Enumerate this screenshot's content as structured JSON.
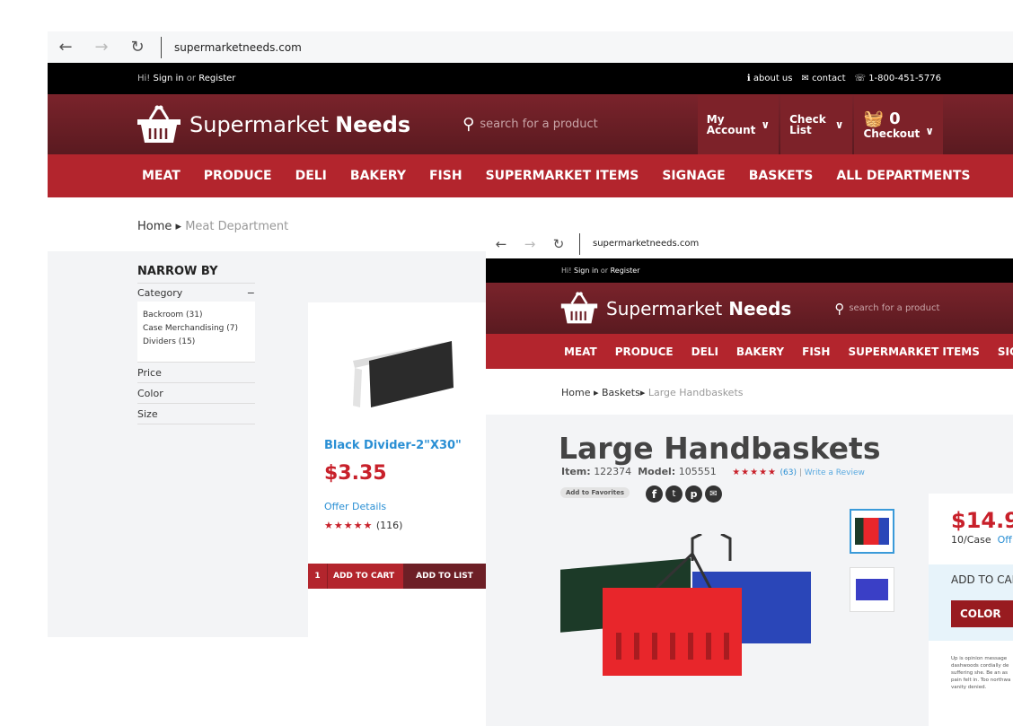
{
  "window1": {
    "url": "supermarketneeds.com",
    "topbar": {
      "greeting": "Hi!",
      "sign_in": "Sign in",
      "or": "or",
      "register": "Register",
      "about": "about us",
      "contact": "contact",
      "phone": "1-800-451-5776"
    },
    "logo": {
      "light": "Supermarket",
      "bold": "Needs"
    },
    "search_placeholder": "search for a product",
    "account": {
      "line1": "My",
      "line2": "Account"
    },
    "checklist": {
      "line1": "Check",
      "line2": "List"
    },
    "cart": {
      "count": "0",
      "label": "Checkout"
    },
    "nav": [
      "MEAT",
      "PRODUCE",
      "DELI",
      "BAKERY",
      "FISH",
      "SUPERMARKET ITEMS",
      "SIGNAGE",
      "BASKETS",
      "ALL DEPARTMENTS"
    ],
    "breadcrumb": {
      "home": "Home",
      "current": "Meat Department"
    },
    "filters": {
      "title": "NARROW BY",
      "category": "Category",
      "category_items": [
        "Backroom (31)",
        "Case Merchandising (7)",
        "Dividers (15)"
      ],
      "others": [
        "Price",
        "Color",
        "Size"
      ]
    },
    "product": {
      "name": "Black Divider-2\"X30\"",
      "price": "$3.35",
      "offer": "Offer Details",
      "stars": "★★★★★",
      "reviews": "(116)",
      "qty": "1",
      "add_cart": "ADD TO CART",
      "add_list": "ADD TO LIST"
    }
  },
  "window2": {
    "url": "supermarketneeds.com",
    "topbar": {
      "greeting": "Hi!",
      "sign_in": "Sign in",
      "or": "or",
      "register": "Register"
    },
    "logo": {
      "light": "Supermarket",
      "bold": "Needs"
    },
    "search_placeholder": "search for a product",
    "nav": [
      "MEAT",
      "PRODUCE",
      "DELI",
      "BAKERY",
      "FISH",
      "SUPERMARKET ITEMS",
      "SIGNAGE"
    ],
    "breadcrumb": {
      "home": "Home",
      "mid": "Baskets",
      "current": "Large Handbaskets"
    },
    "product": {
      "title": "Large Handbaskets",
      "item_label": "Item:",
      "item": "122374",
      "model_label": "Model:",
      "model": "105551",
      "stars": "★★★★★",
      "reviews": "(63)",
      "write_review": "Write a Review",
      "favorites": "Add to Favorites",
      "price": "$14.9",
      "unit": "10/Case",
      "offer": "Off",
      "add_cart": "ADD TO CAR",
      "color": "COLOR",
      "description": "Up is opinion message dashwoods cordially de suffering she. Be an as pain felt in. Too northwa vanity denied."
    }
  },
  "colors": {
    "dark_red": "#6d1f26",
    "nav_red": "#b3252d",
    "price_red": "#c8202a",
    "link_blue": "#2a8fd4"
  }
}
